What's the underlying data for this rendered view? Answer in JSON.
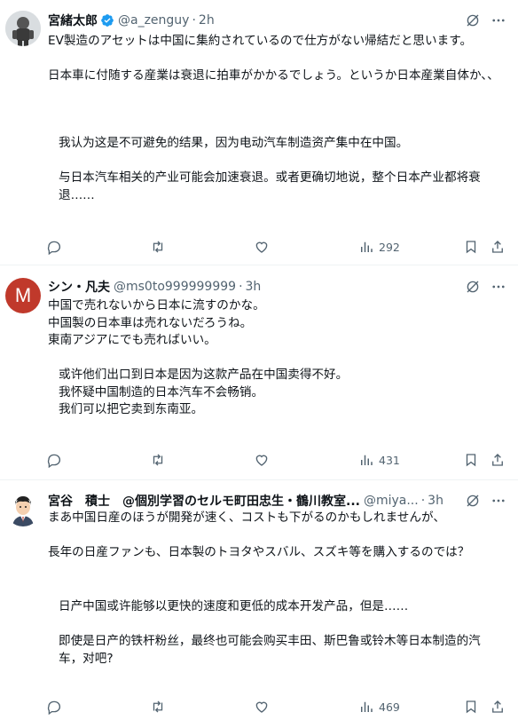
{
  "tweets": [
    {
      "name": "宮緒太郎",
      "handle": "@a_zenguy",
      "dot": "·",
      "time": "2h",
      "verified": true,
      "text_jp": "EV製造のアセットは中国に集約されているので仕方がない帰結だと思います。\n\n日本車に付随する産業は衰退に拍車がかかるでしょう。というか日本産業自体か、、",
      "text_cn": "我认为这是不可避免的结果，因为电动汽车制造资产集中在中国。\n\n与日本汽车相关的产业可能会加速衰退。或者更确切地说，整个日本产业都将衰退……",
      "views": "292"
    },
    {
      "name": "シン・凡夫",
      "handle": "@ms0to999999999",
      "dot": "·",
      "time": "3h",
      "avatar_letter": "M",
      "text_jp": "中国で売れないから日本に流すのかな。\n中国製の日本車は売れないだろうね。\n東南アジアにでも売ればいい。",
      "text_cn": "或许他们出口到日本是因为这款产品在中国卖得不好。\n我怀疑中国制造的日本汽车不会畅销。\n我们可以把它卖到东南亚。",
      "views": "431"
    },
    {
      "name": "宮谷　積士　@個別学習のセルモ町田忠生・鶴川教室...",
      "handle": "@miya...",
      "dot": "·",
      "time": "3h",
      "text_jp": "まあ中国日産のほうが開発が速く、コストも下がるのかもしれませんが、\n\n長年の日産ファンも、日本製のトヨタやスバル、スズキ等を購入するのでは？",
      "text_cn": "日产中国或许能够以更快的速度和更低的成本开发产品，但是……\n\n即使是日产的铁杆粉丝，最终也可能会购买丰田、斯巴鲁或铃木等日本制造的汽车，对吧?",
      "views": "469"
    }
  ],
  "icons": {
    "reply": "reply-icon",
    "retweet": "retweet-icon",
    "like": "heart-icon",
    "views": "views-icon",
    "bookmark": "bookmark-icon",
    "share": "share-icon",
    "grok": "grok-icon",
    "more": "more-icon",
    "verified": "verified-badge-icon"
  },
  "colors": {
    "text": "#0f1419",
    "secondary": "#536471",
    "verified": "#1d9bf0",
    "avatar_m": "#c0392b",
    "separator": "#eff3f4"
  }
}
